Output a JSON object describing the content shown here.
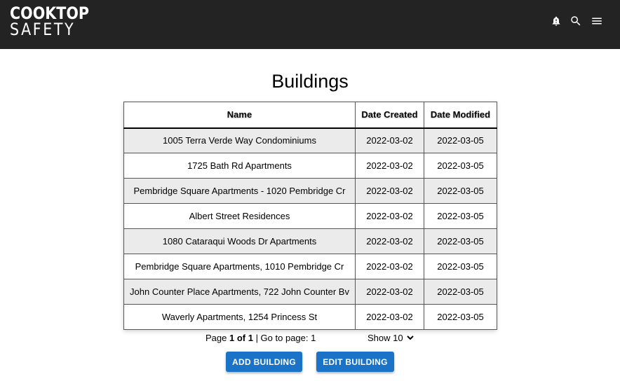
{
  "header": {
    "logo_line1": "COOKTOP",
    "logo_line2": "SAFETY",
    "icons": [
      "alert-icon",
      "search-icon",
      "menu-icon"
    ],
    "background": "#232323"
  },
  "page": {
    "title": "Buildings"
  },
  "table": {
    "columns": [
      "Name",
      "Date Created",
      "Date Modified"
    ],
    "rows": [
      {
        "name": "1005 Terra Verde Way Condominiums",
        "created": "2022-03-02",
        "modified": "2022-03-05"
      },
      {
        "name": "1725 Bath Rd Apartments",
        "created": "2022-03-02",
        "modified": "2022-03-05"
      },
      {
        "name": "Pembridge Square Apartments - 1020 Pembridge Cr",
        "created": "2022-03-02",
        "modified": "2022-03-05"
      },
      {
        "name": "Albert Street Residences",
        "created": "2022-03-02",
        "modified": "2022-03-05"
      },
      {
        "name": "1080 Cataraqui Woods Dr Apartments",
        "created": "2022-03-02",
        "modified": "2022-03-05"
      },
      {
        "name": "Pembridge Square Apartments, 1010 Pembridge Cr",
        "created": "2022-03-02",
        "modified": "2022-03-05"
      },
      {
        "name": "John Counter Place Apartments, 722 John Counter Bv",
        "created": "2022-03-02",
        "modified": "2022-03-05"
      },
      {
        "name": "Waverly Apartments, 1254 Princess St",
        "created": "2022-03-02",
        "modified": "2022-03-05"
      }
    ]
  },
  "pagination": {
    "page_prefix": "Page ",
    "page_current": "1 of 1",
    "goto_text": " | Go to page: 1",
    "show_label": "Show 10"
  },
  "actions": {
    "add_label": "ADD BUILDING",
    "edit_label": "EDIT BUILDING",
    "button_color": "#1a73c7"
  }
}
